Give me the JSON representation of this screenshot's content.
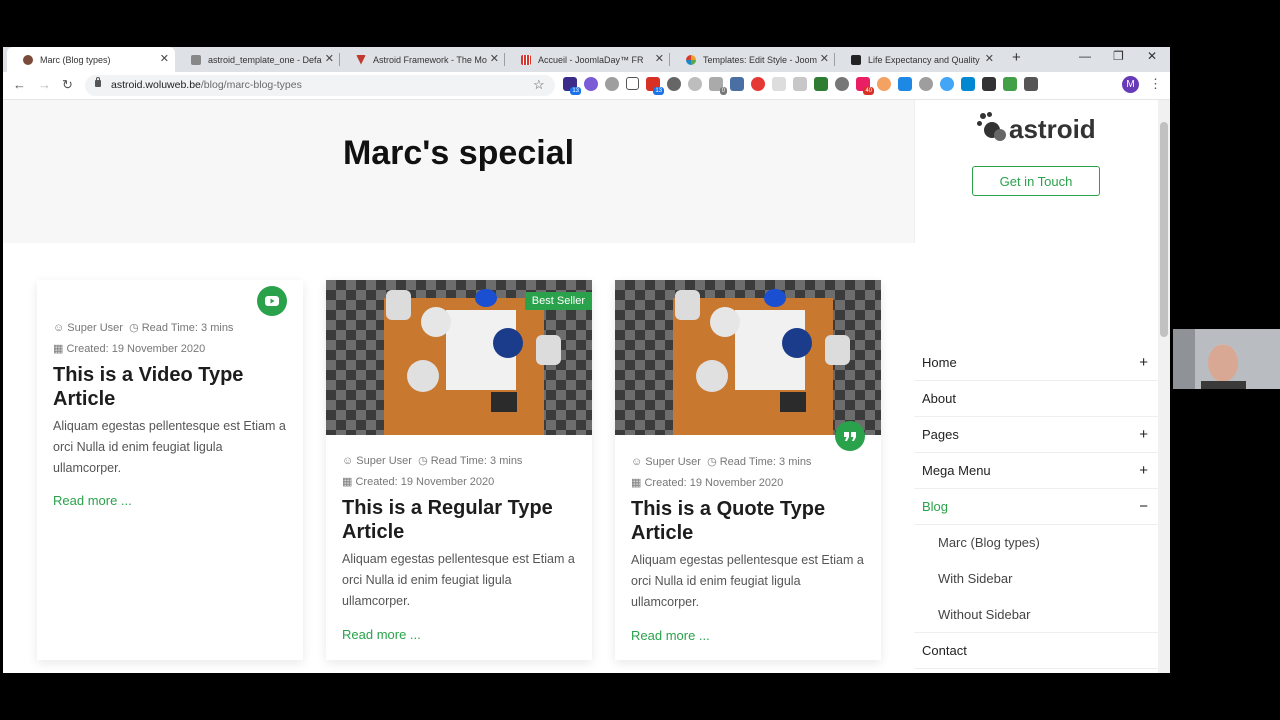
{
  "browser": {
    "tabs": [
      {
        "title": "Marc (Blog types)",
        "active": true,
        "favicon_color": "#7a4a3a"
      },
      {
        "title": "astroid_template_one - Defa",
        "active": false,
        "favicon_color": "#888888"
      },
      {
        "title": "Astroid Framework - The Mo",
        "active": false,
        "favicon_color": "#c0392b"
      },
      {
        "title": "Accueil - JoomlaDay™ FR",
        "active": false,
        "favicon_color": "#d6372e"
      },
      {
        "title": "Templates: Edit Style - Joom",
        "active": false,
        "favicon_color": "#e8a02a"
      },
      {
        "title": "Life Expectancy and Quality",
        "active": false,
        "favicon_color": "#222222"
      }
    ],
    "url_host": "astroid.woluweb.be",
    "url_path": "/blog/marc-blog-types",
    "profile_initial": "M",
    "ext_badges": [
      "13",
      "13",
      "0",
      "40"
    ]
  },
  "page": {
    "hero_title": "Marc's special",
    "logo_text": "astroid",
    "get_in_touch": "Get in Touch",
    "accent_color": "#2aa24b"
  },
  "cards": [
    {
      "author": "Super User",
      "read_time": "Read Time: 3 mins",
      "created": "Created: 19 November 2020",
      "title": "This is a Video Type Article",
      "excerpt": "Aliquam egestas pellentesque est Etiam a orci Nulla id enim feugiat ligula ullamcorper.",
      "read_more": "Read more ..."
    },
    {
      "ribbon": "Best Seller",
      "author": "Super User",
      "read_time": "Read Time: 3 mins",
      "created": "Created: 19 November 2020",
      "title": "This is a Regular Type Article",
      "excerpt": "Aliquam egestas pellentesque est Etiam a orci Nulla id enim feugiat ligula ullamcorper.",
      "read_more": "Read more ..."
    },
    {
      "author": "Super User",
      "read_time": "Read Time: 3 mins",
      "created": "Created: 19 November 2020",
      "title": "This is a Quote Type Article",
      "excerpt": "Aliquam egestas pellentesque est Etiam a orci Nulla id enim feugiat ligula ullamcorper.",
      "read_more": "Read more ..."
    }
  ],
  "menu": {
    "items": [
      {
        "label": "Home",
        "expand": "+"
      },
      {
        "label": "About",
        "expand": ""
      },
      {
        "label": "Pages",
        "expand": "+"
      },
      {
        "label": "Mega Menu",
        "expand": "+"
      },
      {
        "label": "Blog",
        "expand": "−"
      },
      {
        "label": "Contact",
        "expand": ""
      }
    ],
    "blog_sub": [
      "Marc (Blog types)",
      "With Sidebar",
      "Without Sidebar"
    ]
  }
}
